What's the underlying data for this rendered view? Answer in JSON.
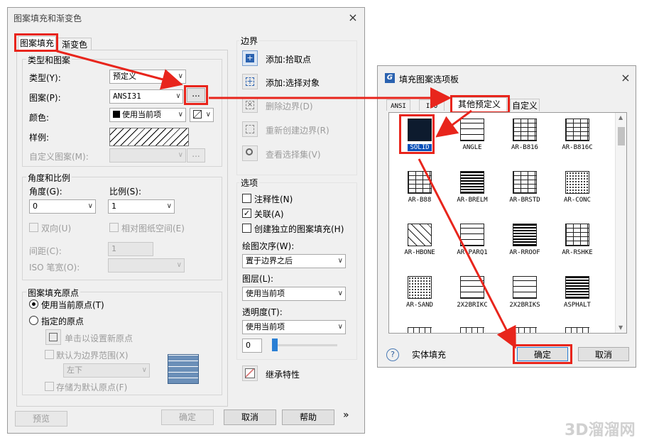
{
  "left_dialog": {
    "title": "图案填充和渐变色",
    "tabs": [
      {
        "label": "图案填充"
      },
      {
        "label": "渐变色"
      }
    ],
    "type_group": {
      "title": "类型和图案",
      "type_label": "类型(Y):",
      "type_value": "预定义",
      "pattern_label": "图案(P):",
      "pattern_value": "ANSI31",
      "ellipsis": "...",
      "color_label": "颜色:",
      "color_value": "使用当前项",
      "sample_label": "样例:",
      "custom_label": "自定义图案(M):"
    },
    "angle_group": {
      "title": "角度和比例",
      "angle_label": "角度(G):",
      "angle_value": "0",
      "scale_label": "比例(S):",
      "scale_value": "1",
      "double_label": "双向(U)",
      "relative_label": "相对图纸空间(E)",
      "spacing_label": "间距(C):",
      "spacing_value": "1",
      "iso_label": "ISO 笔宽(O):"
    },
    "origin_group": {
      "title": "图案填充原点",
      "use_current": "使用当前原点(T)",
      "specified": "指定的原点",
      "click_set": "单击以设置新原点",
      "default_bounds": "默认为边界范围(X)",
      "position_value": "左下",
      "store_default": "存储为默认原点(F)"
    },
    "boundary": {
      "title": "边界",
      "add_pick": "添加:拾取点",
      "add_select": "添加:选择对象",
      "remove": "删除边界(D)",
      "recreate": "重新创建边界(R)",
      "view": "查看选择集(V)"
    },
    "options": {
      "title": "选项",
      "annotative": "注释性(N)",
      "associative": "关联(A)",
      "separate": "创建独立的图案填充(H)",
      "draw_order_label": "绘图次序(W):",
      "draw_order_value": "置于边界之后",
      "layer_label": "图层(L):",
      "layer_value": "使用当前项",
      "transparency_label": "透明度(T):",
      "transparency_value": "使用当前项",
      "transparency_num": "0"
    },
    "inherit": "继承特性",
    "buttons": {
      "preview": "预览",
      "ok": "确定",
      "cancel": "取消",
      "help": "帮助",
      "more": "»"
    }
  },
  "right_dialog": {
    "title": "填充图案选项板",
    "tabs": [
      {
        "label": "ANSI"
      },
      {
        "label": "ISO"
      },
      {
        "label": "其他预定义"
      },
      {
        "label": "自定义"
      }
    ],
    "swatches": [
      {
        "name": "SOLID",
        "pattern": "solid"
      },
      {
        "name": "ANGLE",
        "pattern": "grid"
      },
      {
        "name": "AR-B816",
        "pattern": "brick"
      },
      {
        "name": "AR-B816C",
        "pattern": "brick"
      },
      {
        "name": "AR-B88",
        "pattern": "brick"
      },
      {
        "name": "AR-BRELM",
        "pattern": "dense"
      },
      {
        "name": "AR-BRSTD",
        "pattern": "brick"
      },
      {
        "name": "AR-CONC",
        "pattern": "dots"
      },
      {
        "name": "AR-HBONE",
        "pattern": "diag"
      },
      {
        "name": "AR-PARQ1",
        "pattern": "grid"
      },
      {
        "name": "AR-RROOF",
        "pattern": "dense"
      },
      {
        "name": "AR-RSHKE",
        "pattern": "brick"
      },
      {
        "name": "AR-SAND",
        "pattern": "dots"
      },
      {
        "name": "2X2BRIKC",
        "pattern": "grid"
      },
      {
        "name": "2X2BRIKS",
        "pattern": "grid"
      },
      {
        "name": "ASPHALT",
        "pattern": "dense"
      }
    ],
    "status": "实体填充",
    "help_symbol": "?",
    "ok": "确定",
    "cancel": "取消"
  },
  "watermark": "3D溜溜网",
  "colors": {
    "annotation_red": "#e8251c",
    "selection_blue": "#0a50b8",
    "solid_fill": "#0d1b2e"
  }
}
